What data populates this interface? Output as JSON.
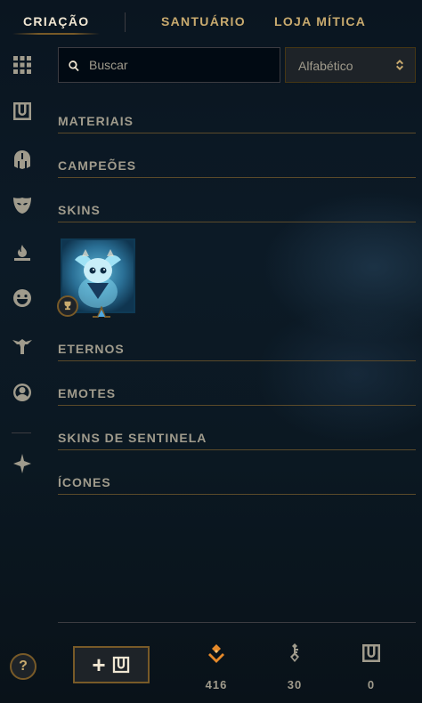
{
  "nav": {
    "tabs": [
      {
        "label": "CRIAÇÃO",
        "active": true
      },
      {
        "label": "SANTUÁRIO",
        "active": false
      },
      {
        "label": "LOJA MÍTICA",
        "active": false
      }
    ]
  },
  "sidebar": {
    "icons": [
      "grid-icon",
      "chest-icon",
      "champion-helmet-icon",
      "skin-mask-icon",
      "ward-flame-icon",
      "emote-face-icon",
      "eternals-icon",
      "profile-icon-icon",
      "sentinel-icon"
    ]
  },
  "search": {
    "placeholder": "Buscar",
    "value": ""
  },
  "sort": {
    "selected": "Alfabético"
  },
  "categories": [
    "MATERIAIS",
    "CAMPEÕES",
    "SKINS",
    "ETERNOS",
    "EMOTES",
    "SKINS DE SENTINELA",
    "ÍCONES"
  ],
  "skin_tile": {
    "icon": "skin-portrait",
    "badge": "trophy-icon",
    "gem": "rarity-gem-icon"
  },
  "bottom": {
    "help_label": "?",
    "craft_plus": "+",
    "currencies": [
      {
        "icon": "orange-essence-icon",
        "value": "416",
        "color": "#e5892a"
      },
      {
        "icon": "key-fragment-icon",
        "value": "30",
        "color": "#a09b8c"
      },
      {
        "icon": "chest-icon",
        "value": "0",
        "color": "#a09b8c"
      }
    ]
  },
  "colors": {
    "gold": "#c8aa6e",
    "gold_dark": "#785a28",
    "text_muted": "#a09b8c",
    "background": "#0a1520"
  }
}
